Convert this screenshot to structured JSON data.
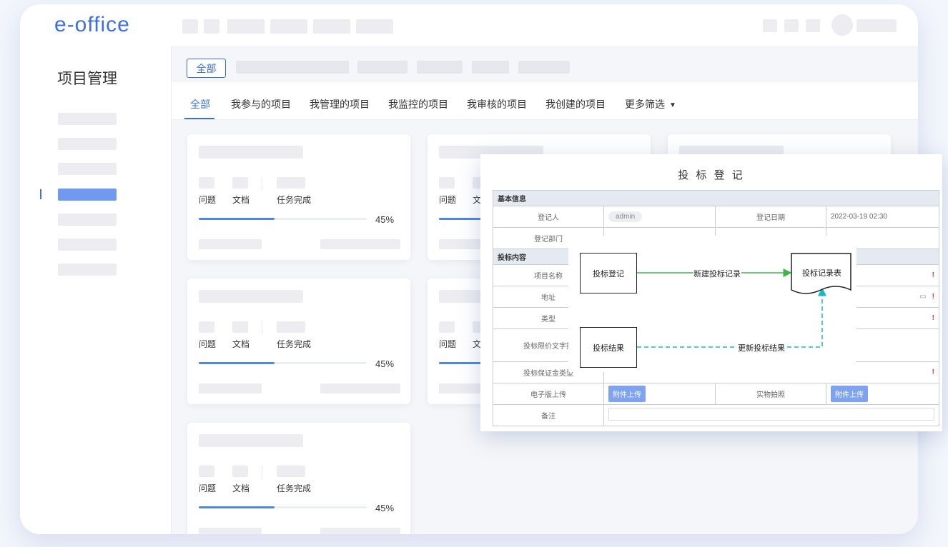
{
  "app": {
    "logo": "e-office"
  },
  "sidebar": {
    "title": "项目管理"
  },
  "filter": {
    "all_label": "全部"
  },
  "tabs": [
    {
      "label": "全部",
      "active": true
    },
    {
      "label": "我参与的项目"
    },
    {
      "label": "我管理的项目"
    },
    {
      "label": "我监控的项目"
    },
    {
      "label": "我审核的项目"
    },
    {
      "label": "我创建的项目"
    },
    {
      "label": "更多筛选"
    }
  ],
  "card": {
    "stat_issue": "问题",
    "stat_doc": "文档",
    "stat_task": "任务完成",
    "progress_percent": 45,
    "progress_text": "45%"
  },
  "form": {
    "title": "投 标 登 记",
    "section_basic": "基本信息",
    "registrant_label": "登记人",
    "registrant_value": "admin",
    "date_label": "登记日期",
    "date_value": "2022-03-19 02:30",
    "dept_label": "登记部门",
    "section_content": "投标内容",
    "project_name_label": "项目名称",
    "address_label": "地址",
    "type_label": "类型",
    "price_label": "投标限价文字描",
    "deposit_label": "投标保证金类型",
    "upload_label": "电子版上传",
    "upload_btn": "附件上传",
    "photo_label": "实物拍照",
    "photo_btn": "附件上传",
    "remark_label": "备注"
  },
  "flow": {
    "node_register": "投标登记",
    "node_table": "投标记录表",
    "node_result": "投标结果",
    "edge_new": "新建投标记录",
    "edge_update": "更新投标结果",
    "colors": {
      "new_edge": "#3bb54a",
      "update_edge": "#1bb7c9"
    }
  }
}
